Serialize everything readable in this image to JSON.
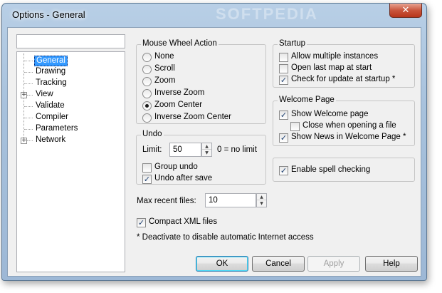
{
  "window": {
    "title": "Options - General",
    "close_glyph": "✕",
    "watermark": "SOFTPEDIA"
  },
  "search": {
    "value": ""
  },
  "tree": {
    "items": [
      {
        "label": "General",
        "selected": true,
        "expandable": false
      },
      {
        "label": "Drawing",
        "expandable": false
      },
      {
        "label": "Tracking",
        "expandable": false
      },
      {
        "label": "View",
        "expandable": true
      },
      {
        "label": "Validate",
        "expandable": false
      },
      {
        "label": "Compiler",
        "expandable": false
      },
      {
        "label": "Parameters",
        "expandable": false
      },
      {
        "label": "Network",
        "expandable": true
      }
    ],
    "expand_glyph": "+"
  },
  "mouse_wheel": {
    "title": "Mouse Wheel Action",
    "options": [
      "None",
      "Scroll",
      "Zoom",
      "Inverse Zoom",
      "Zoom Center",
      "Inverse Zoom Center"
    ],
    "selected": "Zoom Center"
  },
  "undo": {
    "title": "Undo",
    "limit_label": "Limit:",
    "limit_value": "50",
    "limit_hint": "0 = no limit",
    "group_undo": {
      "label": "Group undo",
      "checked": false
    },
    "undo_after_save": {
      "label": "Undo after save",
      "checked": true
    }
  },
  "recent": {
    "label": "Max recent files:",
    "value": "10"
  },
  "compact_xml": {
    "label": "Compact XML files",
    "checked": true
  },
  "footnote": "* Deactivate to disable automatic Internet access",
  "startup": {
    "title": "Startup",
    "allow_multiple": {
      "label": "Allow multiple instances",
      "checked": false
    },
    "open_last_map": {
      "label": "Open last map at start",
      "checked": false
    },
    "check_update": {
      "label": "Check for update at startup *",
      "checked": true
    }
  },
  "welcome": {
    "title": "Welcome Page",
    "show_welcome": {
      "label": "Show Welcome page",
      "checked": true
    },
    "close_on_open": {
      "label": "Close when opening a file",
      "checked": false
    },
    "show_news": {
      "label": "Show News in Welcome Page *",
      "checked": true
    }
  },
  "spell": {
    "label": "Enable spell checking",
    "checked": true
  },
  "buttons": {
    "ok": "OK",
    "cancel": "Cancel",
    "apply": "Apply",
    "help": "Help"
  },
  "glyphs": {
    "check": "✓",
    "spin_up": "▲",
    "spin_down": "▼"
  }
}
